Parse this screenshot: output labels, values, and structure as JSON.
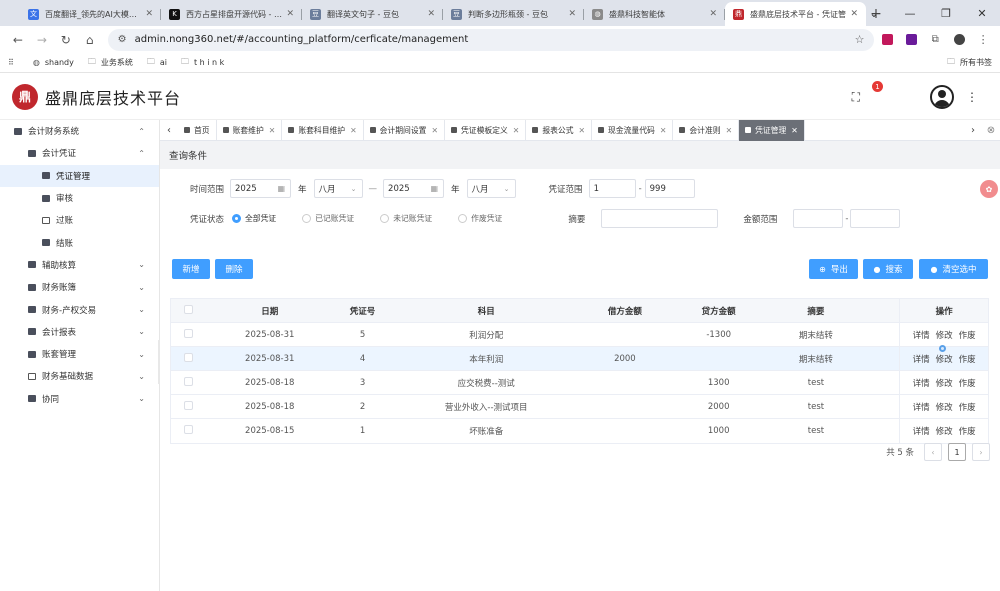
{
  "browser": {
    "tabs": [
      {
        "title": "百度翻译_领先的AI大模型翻",
        "fav_color": "#3b73e8",
        "fav_glyph": "文"
      },
      {
        "title": "西方占星排盘开源代码 - Kim",
        "fav_color": "#111111",
        "fav_glyph": "K"
      },
      {
        "title": "翻译英文句子 - 豆包",
        "fav_color": "#6b7d9b",
        "fav_glyph": "豆"
      },
      {
        "title": "判断多边形瓶颈 - 豆包",
        "fav_color": "#6b7d9b",
        "fav_glyph": "豆"
      },
      {
        "title": "盛鼎科技智能体",
        "fav_color": "#8a8a8a",
        "fav_glyph": "◍"
      },
      {
        "title": "盛鼎底层技术平台 - 凭证管",
        "fav_color": "#c0272d",
        "fav_glyph": "鼎"
      }
    ],
    "url": "admin.nong360.net/#/accounting_platform/cerficate/management",
    "bookmarks": [
      "shandy",
      "业务系统",
      "ai",
      "t h i n k"
    ],
    "all_bookmarks": "所有书签"
  },
  "app": {
    "title": "盛鼎底层技术平台",
    "notification_count": "1"
  },
  "sidebar": {
    "items": [
      {
        "label": "会计财务系统",
        "level": 0,
        "arrow": "⌃"
      },
      {
        "label": "会计凭证",
        "level": 1,
        "arrow": "⌃"
      },
      {
        "label": "凭证管理",
        "level": 2,
        "arrow": "",
        "active": true
      },
      {
        "label": "审核",
        "level": 2,
        "arrow": ""
      },
      {
        "label": "过账",
        "level": 2,
        "arrow": "",
        "folder": true
      },
      {
        "label": "结账",
        "level": 2,
        "arrow": ""
      },
      {
        "label": "辅助核算",
        "level": 1,
        "arrow": "⌄"
      },
      {
        "label": "财务账簿",
        "level": 1,
        "arrow": "⌄"
      },
      {
        "label": "财务-产权交易",
        "level": 1,
        "arrow": "⌄"
      },
      {
        "label": "会计报表",
        "level": 1,
        "arrow": "⌄"
      },
      {
        "label": "账套管理",
        "level": 1,
        "arrow": "⌄"
      },
      {
        "label": "财务基础数据",
        "level": 1,
        "arrow": "⌄",
        "folder": true
      },
      {
        "label": "协同",
        "level": 1,
        "arrow": "⌄"
      }
    ]
  },
  "tagbar": {
    "tags": [
      {
        "label": "首页",
        "closable": false
      },
      {
        "label": "账套维护",
        "closable": true
      },
      {
        "label": "账套科目维护",
        "closable": true
      },
      {
        "label": "会计期间设置",
        "closable": true
      },
      {
        "label": "凭证模板定义",
        "closable": true
      },
      {
        "label": "报表公式",
        "closable": true
      },
      {
        "label": "现金流量代码",
        "closable": true
      },
      {
        "label": "会计准则",
        "closable": true
      },
      {
        "label": "凭证管理",
        "closable": true,
        "active": true
      }
    ]
  },
  "query": {
    "title": "查询条件",
    "time_range_label": "时间范围",
    "year_from": "2025",
    "year_unit": "年",
    "month_from": "八月",
    "range_sep": "—",
    "year_to": "2025",
    "month_to": "八月",
    "voucher_range_label": "凭证范围",
    "voucher_from": "1",
    "voucher_to": "999",
    "dash": "-",
    "status_label": "凭证状态",
    "status_options": [
      "全部凭证",
      "已记账凭证",
      "未记账凭证",
      "作废凭证"
    ],
    "summary_label": "摘要",
    "summary_value": "",
    "amount_label": "金额范围",
    "amount_from": "",
    "amount_to": ""
  },
  "actions": {
    "add": "新增",
    "delete": "删除",
    "export": "导出",
    "search": "搜索",
    "clear": "清空选中"
  },
  "table": {
    "headers": [
      "日期",
      "凭证号",
      "科目",
      "借方金额",
      "贷方金额",
      "摘要",
      "操作"
    ],
    "rows": [
      {
        "date": "2025-08-31",
        "no": "5",
        "subject": "利润分配",
        "debit": "",
        "credit": "-1300",
        "summary": "期末结转"
      },
      {
        "date": "2025-08-31",
        "no": "4",
        "subject": "本年利润",
        "debit": "2000",
        "credit": "",
        "summary": "期末结转"
      },
      {
        "date": "2025-08-18",
        "no": "3",
        "subject": "应交税费--测试",
        "debit": "",
        "credit": "1300",
        "summary": "test"
      },
      {
        "date": "2025-08-18",
        "no": "2",
        "subject": "营业外收入--测试项目",
        "debit": "",
        "credit": "2000",
        "summary": "test"
      },
      {
        "date": "2025-08-15",
        "no": "1",
        "subject": "坏账准备",
        "debit": "",
        "credit": "1000",
        "summary": "test"
      }
    ],
    "ops": [
      "详情",
      "修改",
      "作废"
    ]
  },
  "pager": {
    "total": "共 5 条",
    "current": "1",
    "prev": "‹",
    "next": "›"
  },
  "colors": {
    "primary": "#409eff",
    "brand": "#c0272d",
    "active_tag": "#6b6f77"
  }
}
